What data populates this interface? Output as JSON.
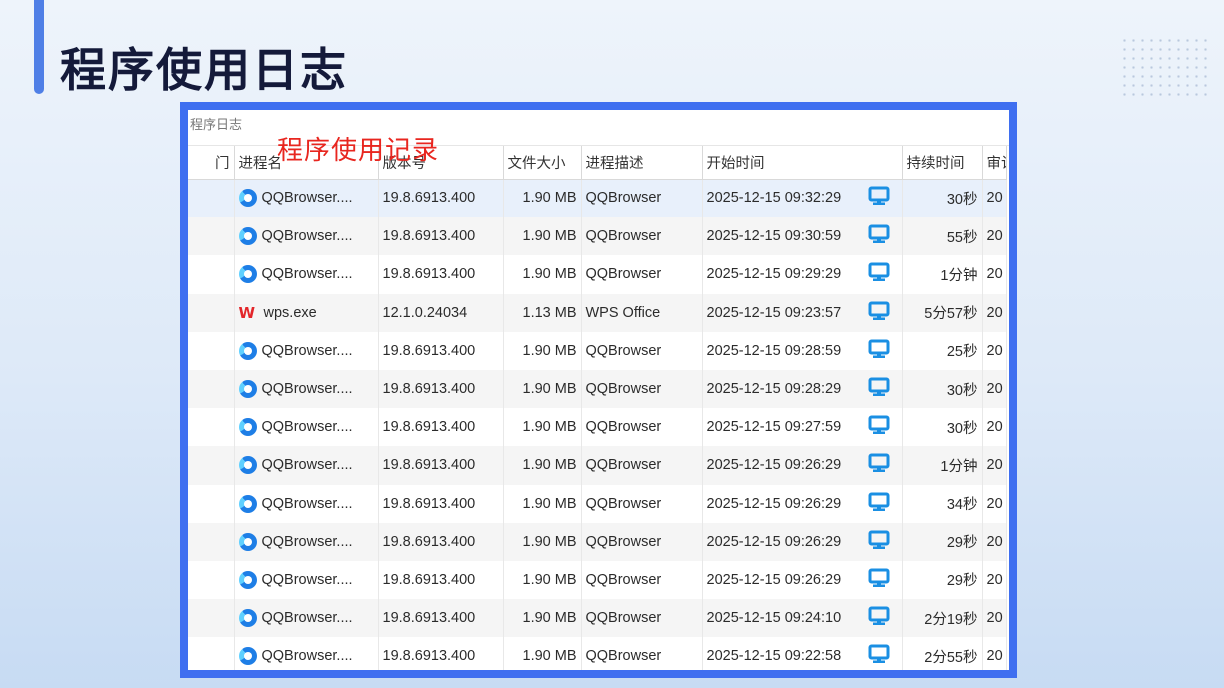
{
  "slide": {
    "title": "程序使用日志"
  },
  "window": {
    "title": "程序日志",
    "annotation": "程序使用记录"
  },
  "table": {
    "columns": [
      "门",
      "进程名",
      "版本号",
      "文件大小",
      "进程描述",
      "开始时间",
      "持续时间",
      "审计"
    ],
    "rows": [
      {
        "icon": "qqbrowser-icon",
        "name": "QQBrowser....",
        "version": "19.8.6913.400",
        "size": "1.90 MB",
        "desc": "QQBrowser",
        "start": "2025-12-15 09:32:29",
        "duration": "30秒",
        "audit": "20",
        "selected": true
      },
      {
        "icon": "qqbrowser-icon",
        "name": "QQBrowser....",
        "version": "19.8.6913.400",
        "size": "1.90 MB",
        "desc": "QQBrowser",
        "start": "2025-12-15 09:30:59",
        "duration": "55秒",
        "audit": "20"
      },
      {
        "icon": "qqbrowser-icon",
        "name": "QQBrowser....",
        "version": "19.8.6913.400",
        "size": "1.90 MB",
        "desc": "QQBrowser",
        "start": "2025-12-15 09:29:29",
        "duration": "1分钟",
        "audit": "20"
      },
      {
        "icon": "wps-icon",
        "name": "wps.exe",
        "version": "12.1.0.24034",
        "size": "1.13 MB",
        "desc": "WPS Office",
        "start": "2025-12-15 09:23:57",
        "duration": "5分57秒",
        "audit": "20"
      },
      {
        "icon": "qqbrowser-icon",
        "name": "QQBrowser....",
        "version": "19.8.6913.400",
        "size": "1.90 MB",
        "desc": "QQBrowser",
        "start": "2025-12-15 09:28:59",
        "duration": "25秒",
        "audit": "20"
      },
      {
        "icon": "qqbrowser-icon",
        "name": "QQBrowser....",
        "version": "19.8.6913.400",
        "size": "1.90 MB",
        "desc": "QQBrowser",
        "start": "2025-12-15 09:28:29",
        "duration": "30秒",
        "audit": "20"
      },
      {
        "icon": "qqbrowser-icon",
        "name": "QQBrowser....",
        "version": "19.8.6913.400",
        "size": "1.90 MB",
        "desc": "QQBrowser",
        "start": "2025-12-15 09:27:59",
        "duration": "30秒",
        "audit": "20"
      },
      {
        "icon": "qqbrowser-icon",
        "name": "QQBrowser....",
        "version": "19.8.6913.400",
        "size": "1.90 MB",
        "desc": "QQBrowser",
        "start": "2025-12-15 09:26:29",
        "duration": "1分钟",
        "audit": "20"
      },
      {
        "icon": "qqbrowser-icon",
        "name": "QQBrowser....",
        "version": "19.8.6913.400",
        "size": "1.90 MB",
        "desc": "QQBrowser",
        "start": "2025-12-15 09:26:29",
        "duration": "34秒",
        "audit": "20"
      },
      {
        "icon": "qqbrowser-icon",
        "name": "QQBrowser....",
        "version": "19.8.6913.400",
        "size": "1.90 MB",
        "desc": "QQBrowser",
        "start": "2025-12-15 09:26:29",
        "duration": "29秒",
        "audit": "20"
      },
      {
        "icon": "qqbrowser-icon",
        "name": "QQBrowser....",
        "version": "19.8.6913.400",
        "size": "1.90 MB",
        "desc": "QQBrowser",
        "start": "2025-12-15 09:26:29",
        "duration": "29秒",
        "audit": "20"
      },
      {
        "icon": "qqbrowser-icon",
        "name": "QQBrowser....",
        "version": "19.8.6913.400",
        "size": "1.90 MB",
        "desc": "QQBrowser",
        "start": "2025-12-15 09:24:10",
        "duration": "2分19秒",
        "audit": "20"
      },
      {
        "icon": "qqbrowser-icon",
        "name": "QQBrowser....",
        "version": "19.8.6913.400",
        "size": "1.90 MB",
        "desc": "QQBrowser",
        "start": "2025-12-15 09:22:58",
        "duration": "2分55秒",
        "audit": "20"
      }
    ]
  },
  "colors": {
    "frame_border": "#3f6ff0",
    "annotation": "#e8261f",
    "monitor_icon": "#1a8fe3",
    "selected_row": "#e8f0fb"
  }
}
